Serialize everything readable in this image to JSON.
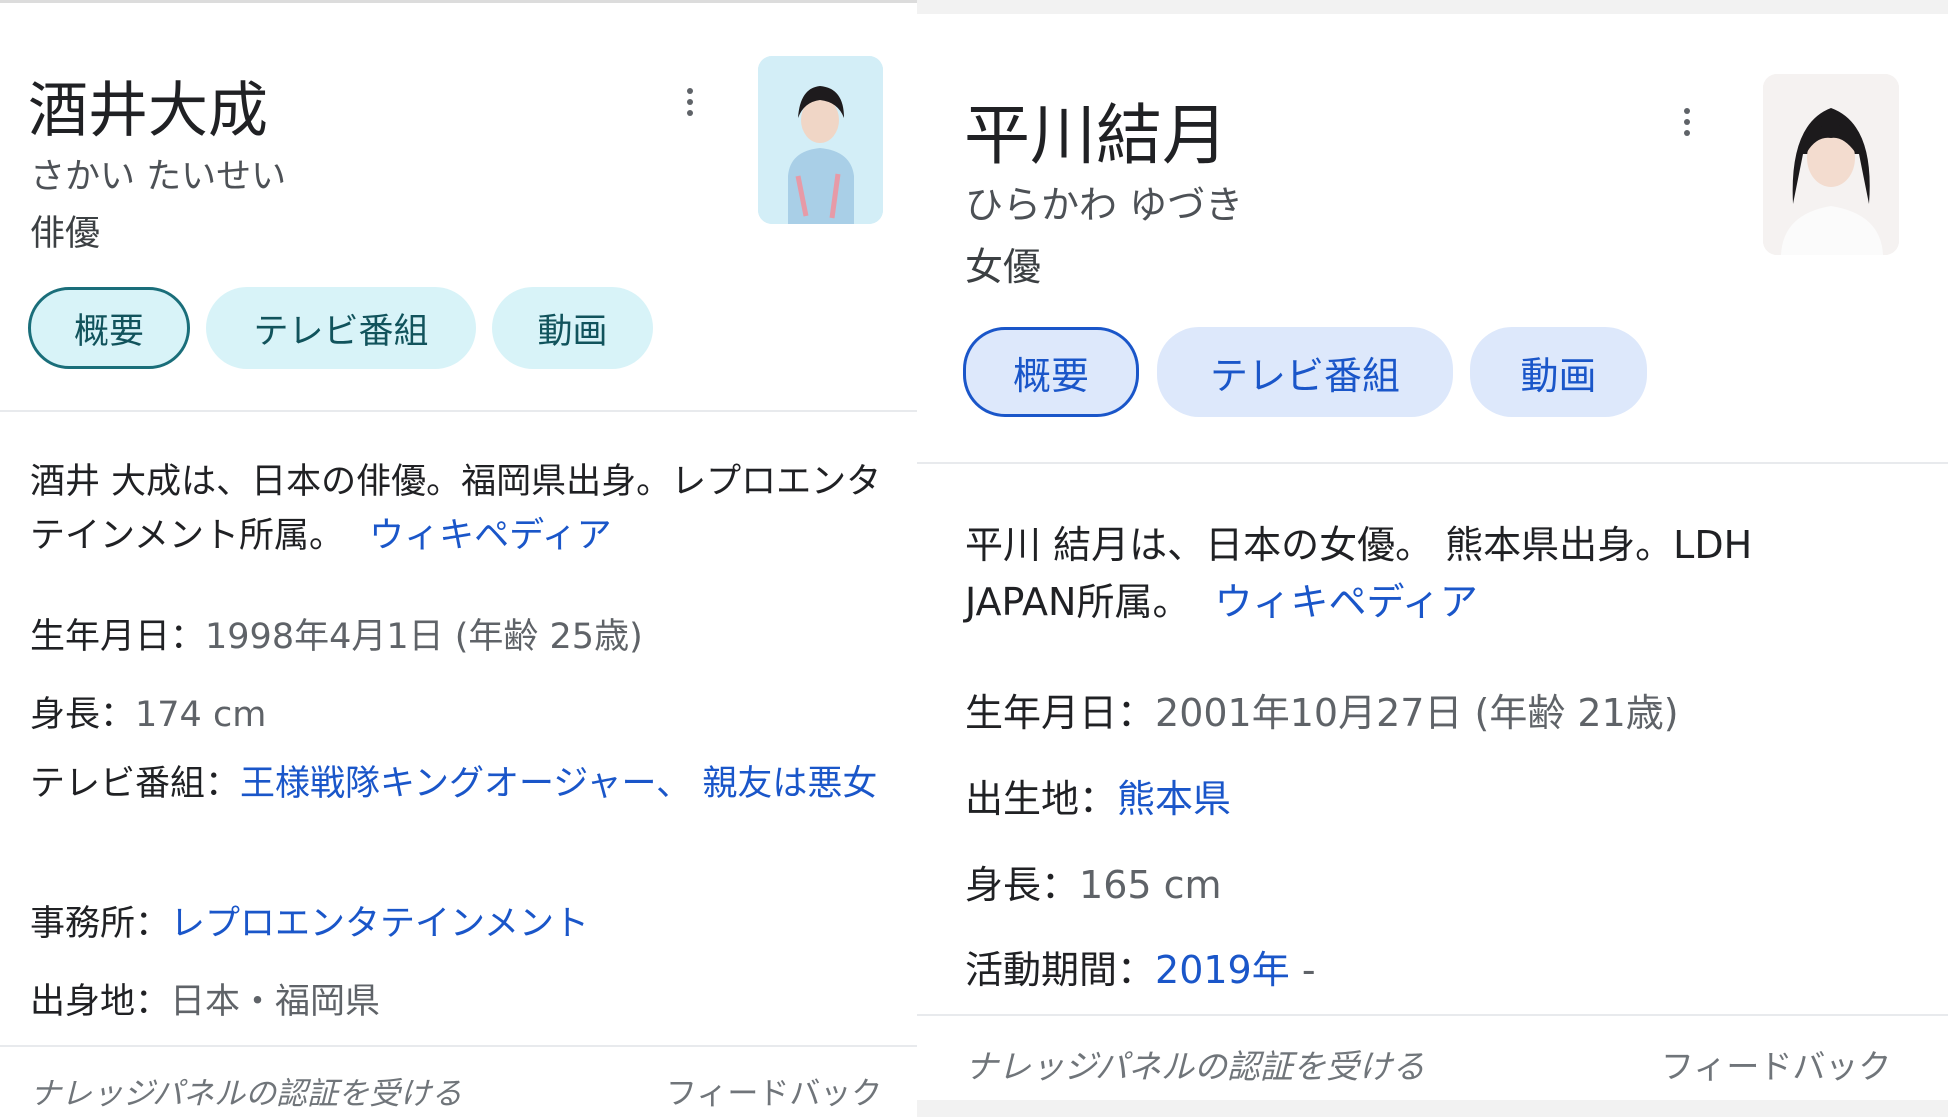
{
  "left": {
    "name": "酒井大成",
    "reading": "さかい たいせい",
    "role": "俳優",
    "chips": [
      "概要",
      "テレビ番組",
      "動画"
    ],
    "description": "酒井 大成は、日本の俳優。福岡県出身。レプロエンタテインメント所属。",
    "source_link": "ウィキペディア",
    "facts": {
      "birth_label": "生年月日：",
      "birth_value": "1998年4月1日 (年齢 25歳)",
      "height_label": "身長：",
      "height_value": "174 cm",
      "tv_label": "テレビ番組：",
      "tv_link1": "王様戦隊キングオージャー",
      "tv_sep": "、",
      "tv_link2": "親友は悪女",
      "agency_label": "事務所：",
      "agency_link": "レプロエンタテインメント",
      "origin_label": "出身地：",
      "origin_value": "日本・福岡県"
    },
    "footer_left": "ナレッジパネルの認証を受ける",
    "footer_right": "フィードバック"
  },
  "right": {
    "name": "平川結月",
    "reading": "ひらかわ ゆづき",
    "role": "女優",
    "chips": [
      "概要",
      "テレビ番組",
      "動画"
    ],
    "description": "平川 結月は、日本の女優。 熊本県出身。LDH JAPAN所属。",
    "source_link": "ウィキペディア",
    "facts": {
      "birth_label": "生年月日：",
      "birth_value": "2001年10月27日 (年齢 21歳)",
      "birthplace_label": "出生地：",
      "birthplace_link": "熊本県",
      "height_label": "身長：",
      "height_value": "165 cm",
      "active_label": "活動期間：",
      "active_link": "2019年",
      "active_suffix": " -"
    },
    "footer_left": "ナレッジパネルの認証を受ける",
    "footer_right": "フィードバック"
  },
  "colors": {
    "left_chip_bg": "#d8f3f8",
    "left_chip_border": "#1a6e7a",
    "left_chip_text": "#11535c",
    "right_chip_bg": "#dde8fb",
    "right_chip_border": "#1a56c9",
    "right_chip_text": "#1a56c9",
    "link": "#1a56c9"
  },
  "icons": [
    "more-vert-icon"
  ]
}
